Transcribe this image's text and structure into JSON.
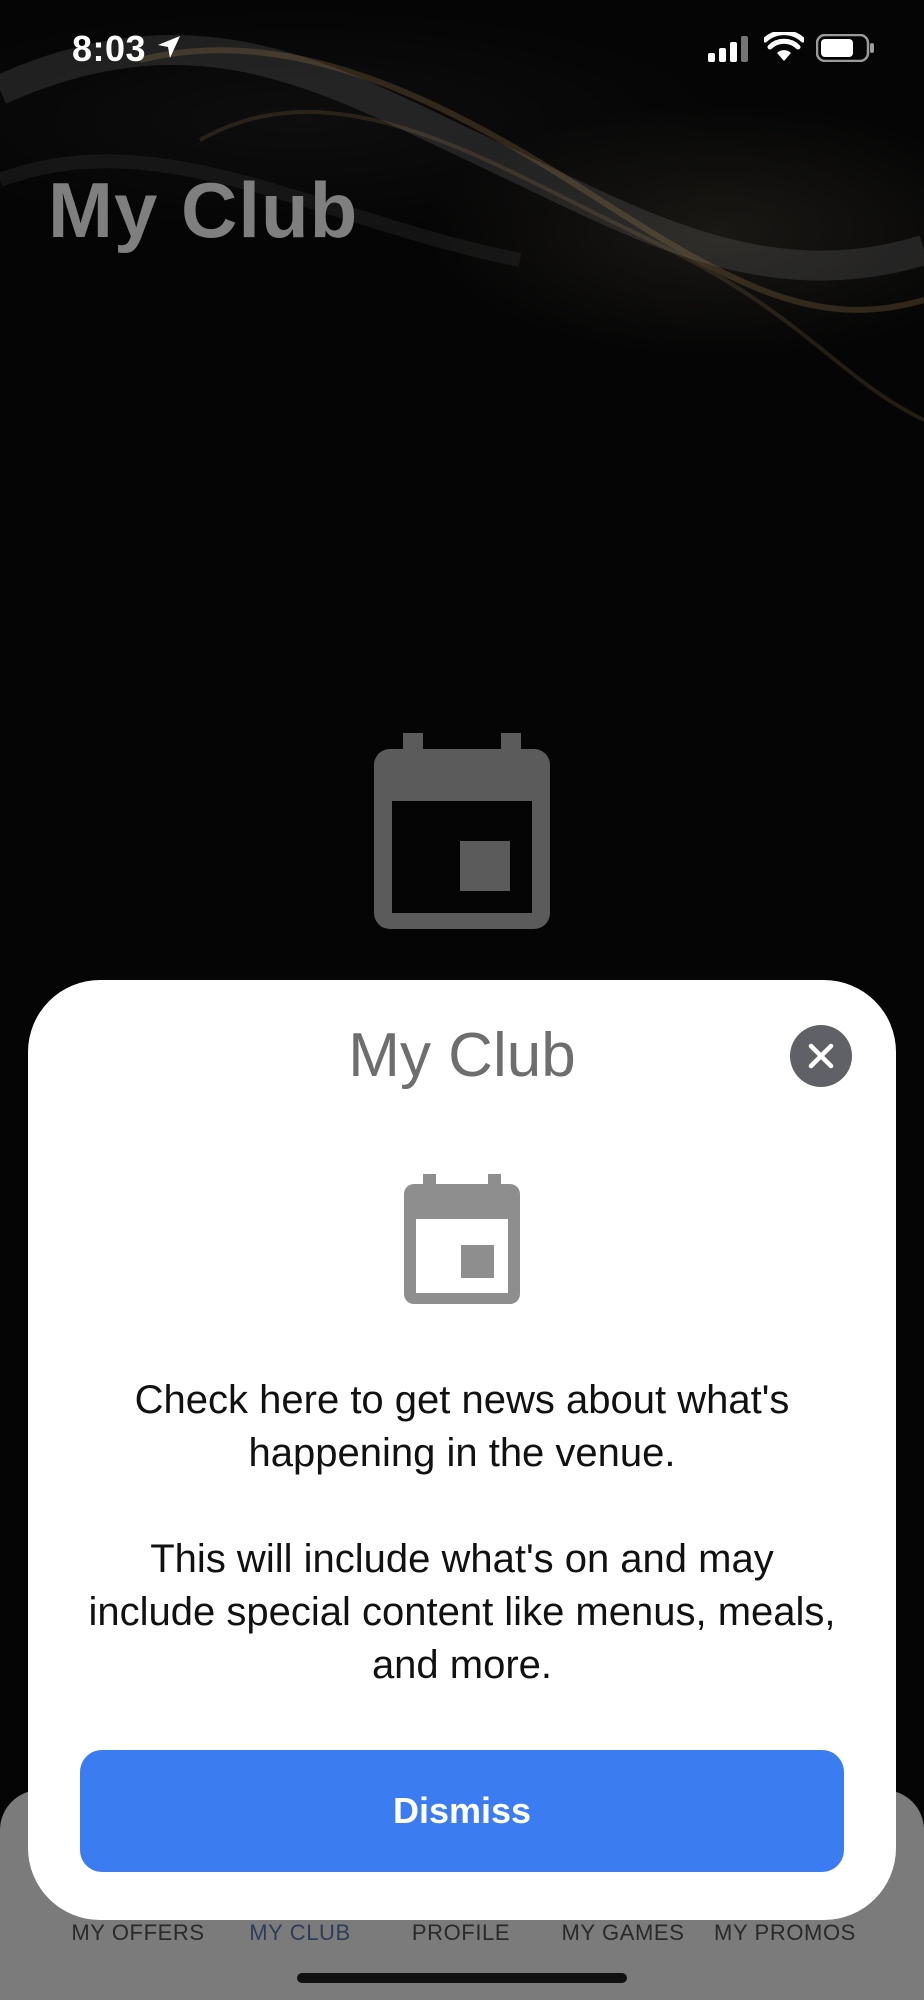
{
  "status_bar": {
    "time": "8:03"
  },
  "screen": {
    "title": "My Club",
    "empty_icon": "calendar-icon"
  },
  "tabbar": {
    "tabs": [
      {
        "label": "MY OFFERS"
      },
      {
        "label": "MY CLUB",
        "active": true
      },
      {
        "label": "PROFILE"
      },
      {
        "label": "MY GAMES"
      },
      {
        "label": "MY PROMOS"
      }
    ]
  },
  "modal": {
    "title": "My Club",
    "icon": "calendar-icon",
    "close_icon": "close-icon",
    "paragraph_1": "Check here to get news about what's happening in the venue.",
    "paragraph_2": "This will include what's on and may include special content like menus, meals, and more.",
    "dismiss_label": "Dismiss"
  },
  "colors": {
    "accent": "#3B7CF0",
    "close_button": "#5F6167",
    "muted_title": "#6E6E6E"
  }
}
